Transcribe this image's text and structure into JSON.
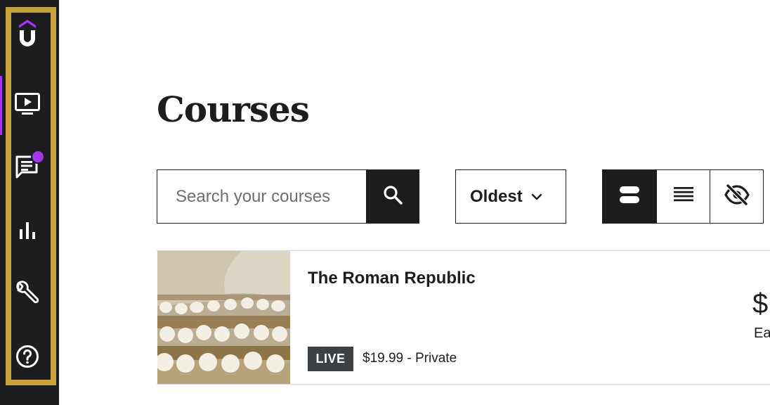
{
  "sidebar": {
    "items": [
      {
        "icon": "udemy-logo-icon",
        "label": "Udemy"
      },
      {
        "icon": "courses-icon",
        "label": "Courses"
      },
      {
        "icon": "communication-icon",
        "label": "Communication"
      },
      {
        "icon": "performance-icon",
        "label": "Performance"
      },
      {
        "icon": "tools-icon",
        "label": "Tools"
      },
      {
        "icon": "help-icon",
        "label": "Resources"
      }
    ],
    "notification_color": "#a435f0",
    "highlight_color": "#c9a13c"
  },
  "page": {
    "title": "Courses"
  },
  "search": {
    "placeholder": "Search your courses",
    "value": ""
  },
  "sort": {
    "label": "Oldest"
  },
  "view_toggle": {
    "options": [
      "card-view",
      "list-view",
      "hidden-courses"
    ],
    "selected": "card-view"
  },
  "courses": [
    {
      "title": "The Roman Republic",
      "badge": "LIVE",
      "price": "$19.99 - Private",
      "earnings_amount": "$",
      "earnings_label": "Ea"
    }
  ],
  "colors": {
    "brand_purple": "#a435f0",
    "dark": "#1c1d1f",
    "badge_bg": "#3e4143"
  }
}
